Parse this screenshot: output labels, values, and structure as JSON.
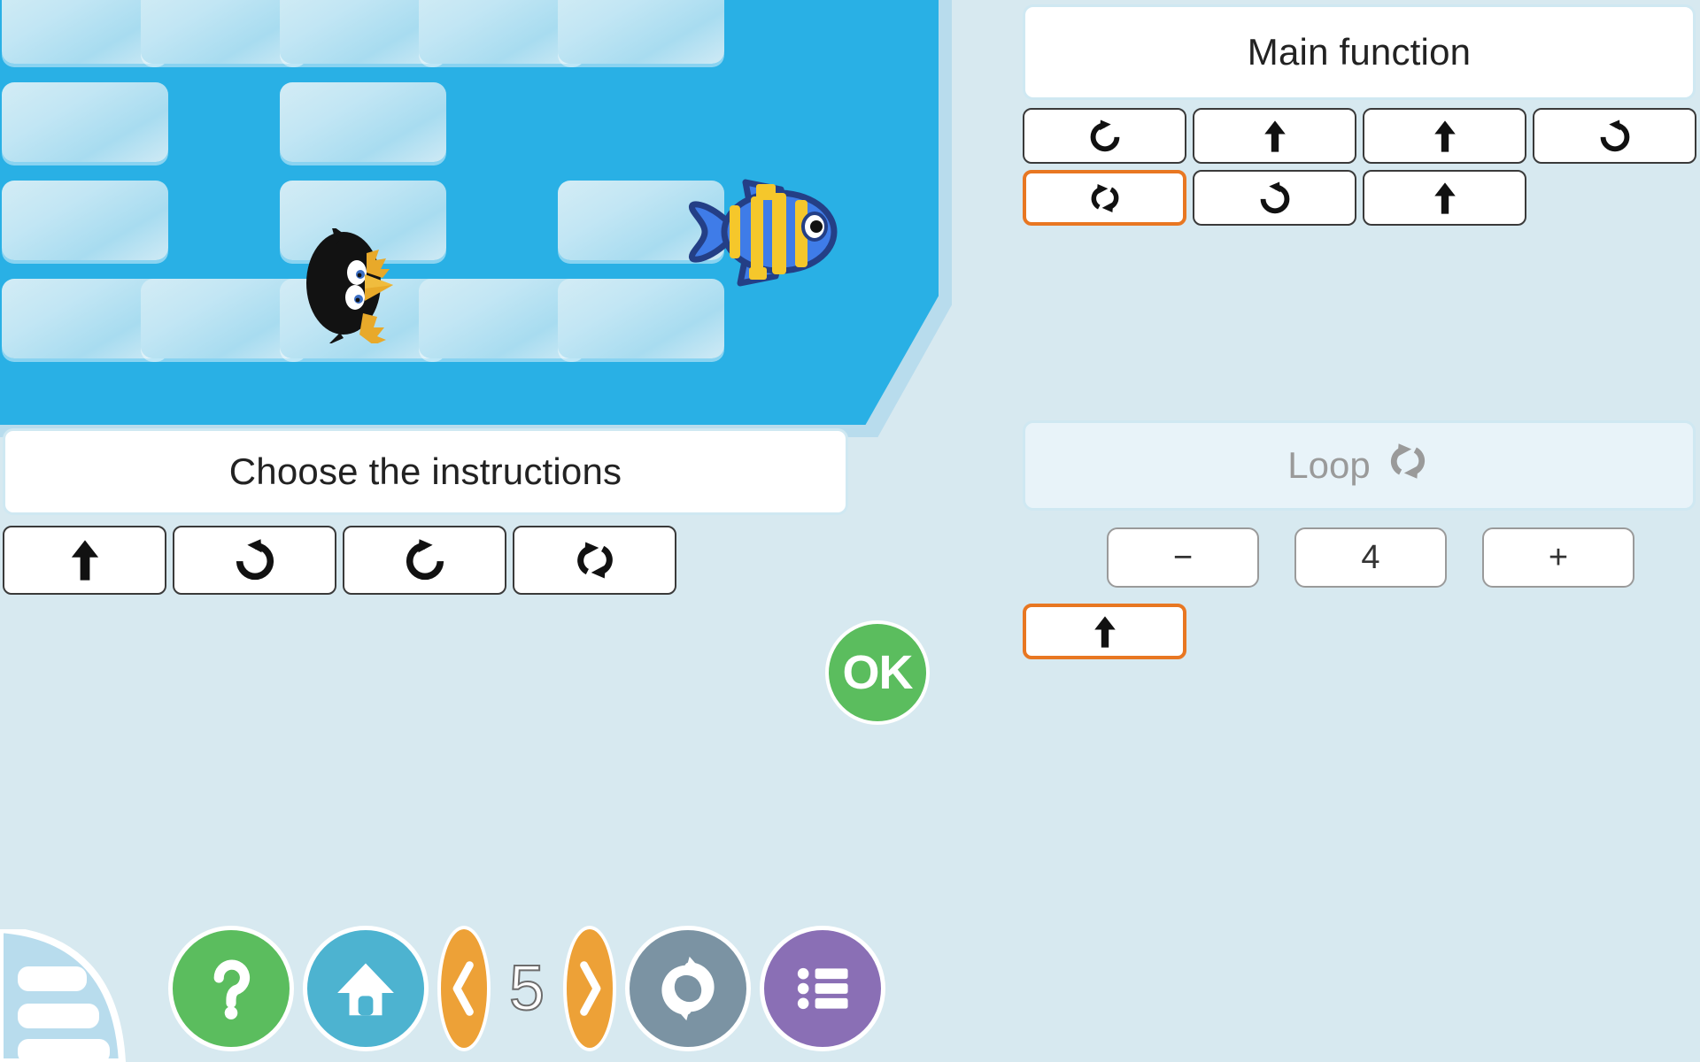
{
  "board": {
    "bg_color": "#29b0e5",
    "tile_color": "#c2e6f4",
    "rows": 4,
    "cols": 5,
    "tiles": [
      [
        1,
        1,
        1,
        1,
        1
      ],
      [
        1,
        0,
        1,
        0,
        0
      ],
      [
        1,
        0,
        1,
        0,
        1
      ],
      [
        1,
        1,
        1,
        1,
        1
      ]
    ],
    "penguin": {
      "row": 3,
      "col": 2,
      "facing": "east",
      "name": "penguin-sprite"
    },
    "fish": {
      "row": 2,
      "col": 4,
      "facing": "east",
      "name": "fish-sprite"
    }
  },
  "choose": {
    "title": "Choose the instructions",
    "palette": [
      {
        "icon": "arrow-up-icon",
        "label": "Move forward"
      },
      {
        "icon": "rotate-left-icon",
        "label": "Turn left"
      },
      {
        "icon": "rotate-right-icon",
        "label": "Turn right"
      },
      {
        "icon": "loop-icon",
        "label": "Loop"
      }
    ]
  },
  "ok_button": {
    "label": "OK"
  },
  "main_function": {
    "title": "Main function",
    "instructions": [
      {
        "icon": "rotate-right-icon",
        "selected": false
      },
      {
        "icon": "arrow-up-icon",
        "selected": false
      },
      {
        "icon": "arrow-up-icon",
        "selected": false
      },
      {
        "icon": "rotate-left-icon",
        "selected": false
      },
      {
        "icon": "loop-icon",
        "selected": true
      },
      {
        "icon": "rotate-left-icon",
        "selected": false
      },
      {
        "icon": "arrow-up-icon",
        "selected": false
      }
    ]
  },
  "loop": {
    "title": "Loop",
    "title_icon": "loop-icon",
    "minus_label": "−",
    "count": "4",
    "plus_label": "+",
    "body": [
      {
        "icon": "arrow-up-icon",
        "selected": true
      }
    ]
  },
  "toolbar": {
    "items": [
      {
        "icon": "document-icon",
        "label": "Instructions sheet",
        "color": "#b8dced"
      },
      {
        "icon": "help-icon",
        "label": "?",
        "color": "#5bbd5e"
      },
      {
        "icon": "home-icon",
        "label": "Home",
        "color": "#4db3d0"
      },
      {
        "icon": "prev-level-icon",
        "label": "Previous level",
        "color": "#eda137"
      },
      {
        "icon": "level-number",
        "label": "5",
        "color": "#ffffff"
      },
      {
        "icon": "next-level-icon",
        "label": "Next level",
        "color": "#eda137"
      },
      {
        "icon": "restart-icon",
        "label": "Restart",
        "color": "#7b93a3"
      },
      {
        "icon": "menu-list-icon",
        "label": "Level list",
        "color": "#8a6fb5"
      }
    ]
  },
  "colors": {
    "accent_orange": "#e87722",
    "background": "#d7e9f0",
    "board_blue": "#29b0e5",
    "ok_green": "#5bbd5e"
  }
}
